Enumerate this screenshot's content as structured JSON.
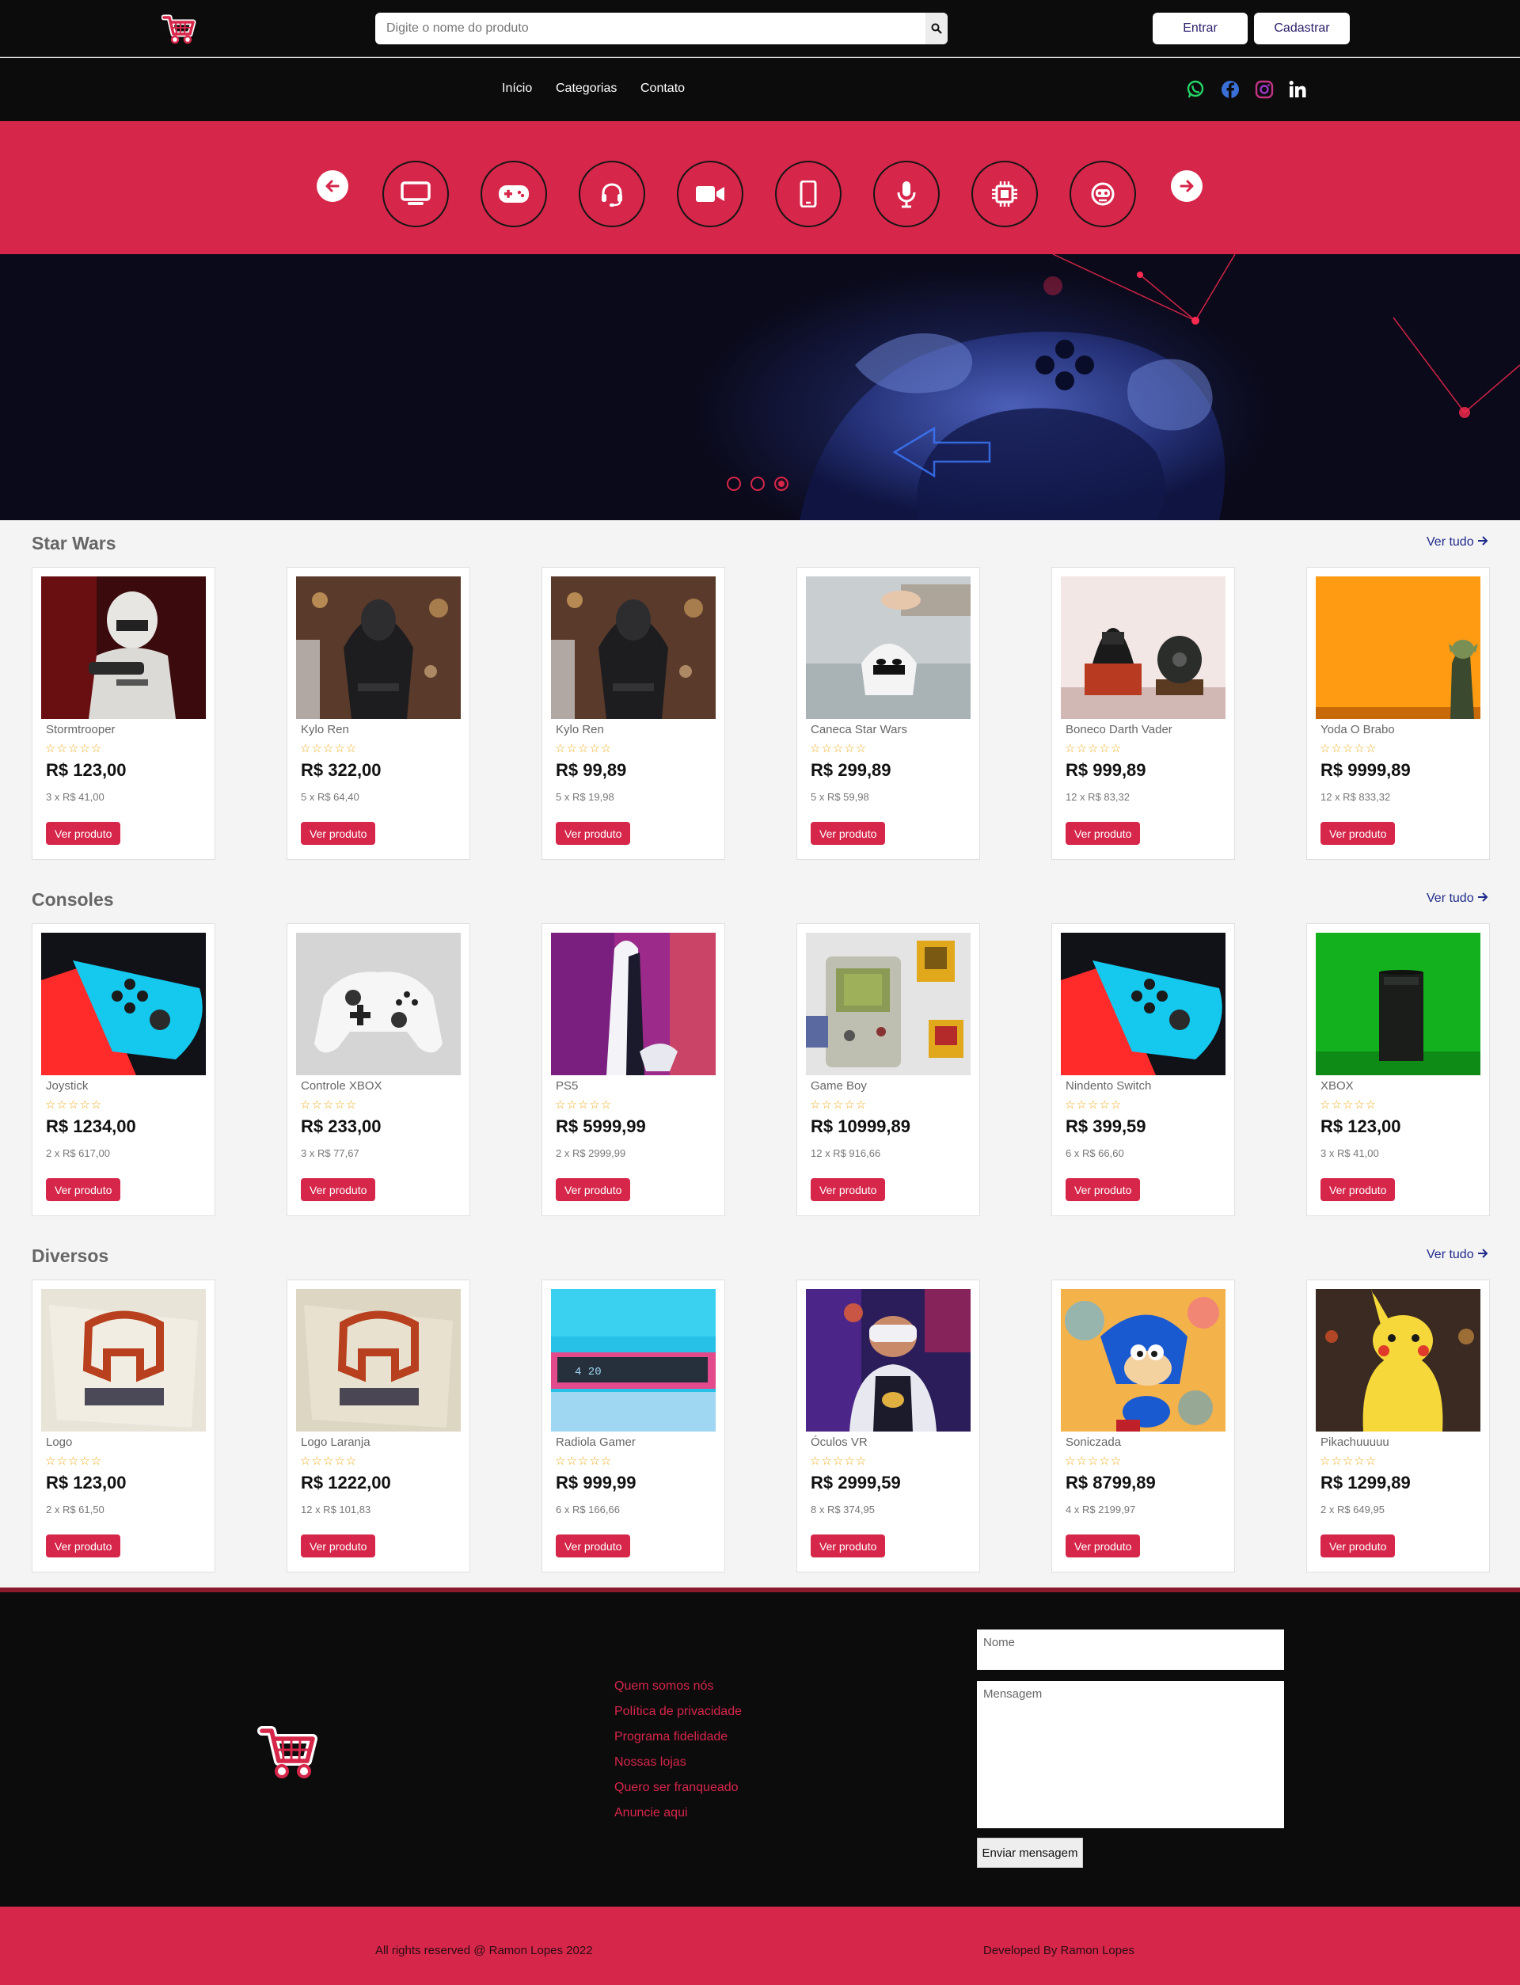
{
  "header": {
    "search_placeholder": "Digite o nome do produto",
    "login_label": "Entrar",
    "signup_label": "Cadastrar"
  },
  "nav": {
    "links": [
      "Início",
      "Categorias",
      "Contato"
    ],
    "social": [
      "whatsapp-icon",
      "facebook-icon",
      "instagram-icon",
      "linkedin-icon"
    ]
  },
  "categories": [
    "monitor-icon",
    "gamepad-icon",
    "headset-icon",
    "video-camera-icon",
    "phone-icon",
    "microphone-icon",
    "chip-icon",
    "robot-icon"
  ],
  "hero": {
    "slides": 3,
    "active_slide": 3
  },
  "sections": [
    {
      "title": "Star Wars",
      "see_all": "Ver tudo",
      "products": [
        {
          "name": "Stormtrooper",
          "price": "R$ 123,00",
          "installments": "3 x R$ 41,00",
          "button": "Ver produto"
        },
        {
          "name": "Kylo Ren",
          "price": "R$ 322,00",
          "installments": "5 x R$ 64,40",
          "button": "Ver produto"
        },
        {
          "name": "Kylo Ren",
          "price": "R$ 99,89",
          "installments": "5 x R$ 19,98",
          "button": "Ver produto"
        },
        {
          "name": "Caneca Star Wars",
          "price": "R$ 299,89",
          "installments": "5 x R$ 59,98",
          "button": "Ver produto"
        },
        {
          "name": "Boneco Darth Vader",
          "price": "R$ 999,89",
          "installments": "12 x R$ 83,32",
          "button": "Ver produto"
        },
        {
          "name": "Yoda O Brabo",
          "price": "R$ 9999,89",
          "installments": "12 x R$ 833,32",
          "button": "Ver produto"
        }
      ]
    },
    {
      "title": "Consoles",
      "see_all": "Ver tudo",
      "products": [
        {
          "name": "Joystick",
          "price": "R$ 1234,00",
          "installments": "2 x R$ 617,00",
          "button": "Ver produto"
        },
        {
          "name": "Controle XBOX",
          "price": "R$ 233,00",
          "installments": "3 x R$ 77,67",
          "button": "Ver produto"
        },
        {
          "name": "PS5",
          "price": "R$ 5999,99",
          "installments": "2 x R$ 2999,99",
          "button": "Ver produto"
        },
        {
          "name": "Game Boy",
          "price": "R$ 10999,89",
          "installments": "12 x R$ 916,66",
          "button": "Ver produto"
        },
        {
          "name": "Nindento Switch",
          "price": "R$ 399,59",
          "installments": "6 x R$ 66,60",
          "button": "Ver produto"
        },
        {
          "name": "XBOX",
          "price": "R$ 123,00",
          "installments": "3 x R$ 41,00",
          "button": "Ver produto"
        }
      ]
    },
    {
      "title": "Diversos",
      "see_all": "Ver tudo",
      "products": [
        {
          "name": "Logo",
          "price": "R$ 123,00",
          "installments": "2 x R$ 61,50",
          "button": "Ver produto"
        },
        {
          "name": "Logo Laranja",
          "price": "R$ 1222,00",
          "installments": "12 x R$ 101,83",
          "button": "Ver produto"
        },
        {
          "name": "Radiola Gamer",
          "price": "R$ 999,99",
          "installments": "6 x R$ 166,66",
          "button": "Ver produto"
        },
        {
          "name": "Óculos VR",
          "price": "R$ 2999,59",
          "installments": "8 x R$ 374,95",
          "button": "Ver produto"
        },
        {
          "name": "Soniczada",
          "price": "R$ 8799,89",
          "installments": "4 x R$ 2199,97",
          "button": "Ver produto"
        },
        {
          "name": "Pikachuuuuu",
          "price": "R$ 1299,89",
          "installments": "2 x R$ 649,95",
          "button": "Ver produto"
        }
      ]
    }
  ],
  "footer": {
    "links": [
      "Quem somos nós",
      "Política de privacidade",
      "Programa fidelidade",
      "Nossas lojas",
      "Quero ser franqueado",
      "Anuncie aqui"
    ],
    "name_placeholder": "Nome",
    "message_placeholder": "Mensagem",
    "send_label": "Enviar mensagem",
    "rights": "All rights reserved @ Ramon Lopes 2022",
    "developer": "Developed By Ramon Lopes"
  },
  "colors": {
    "accent": "#d6264a",
    "dark": "#0c0c0d",
    "link_blue": "#1f2a8a"
  }
}
